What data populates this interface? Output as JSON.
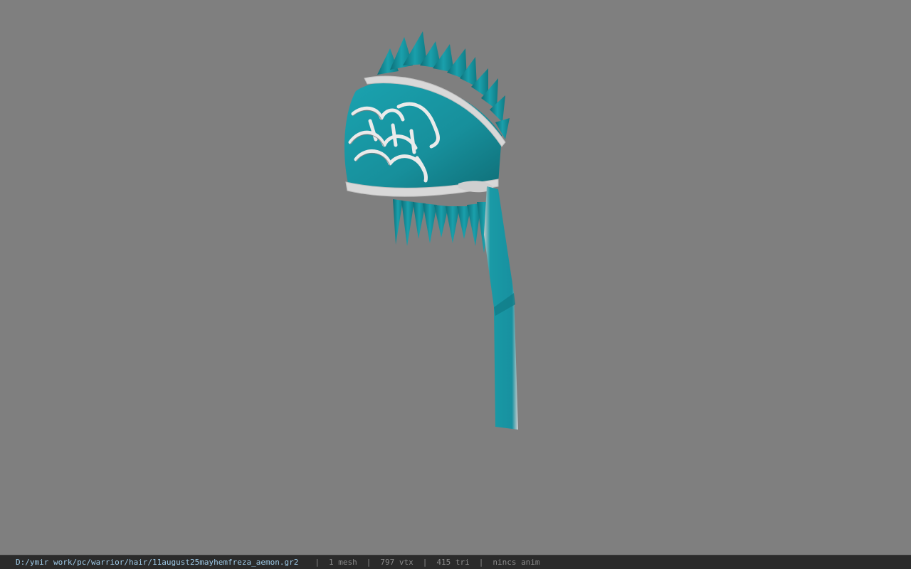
{
  "viewer": {
    "background_color": "#7f7f7f",
    "model": {
      "icon": "hair-model-icon",
      "primary_color": "#1f9aa6",
      "trim_color": "#d6d6d6",
      "emblem_color": "#e8e8e8"
    }
  },
  "statusbar": {
    "file_path": "D:/ymir work/pc/warrior/hair/11august25mayhemfreza_aemon.gr2",
    "separator": "|",
    "mesh_count": "1 mesh",
    "vertex_count": "797 vtx",
    "triangle_count": "415 tri",
    "anim_info": "nincs anim"
  }
}
